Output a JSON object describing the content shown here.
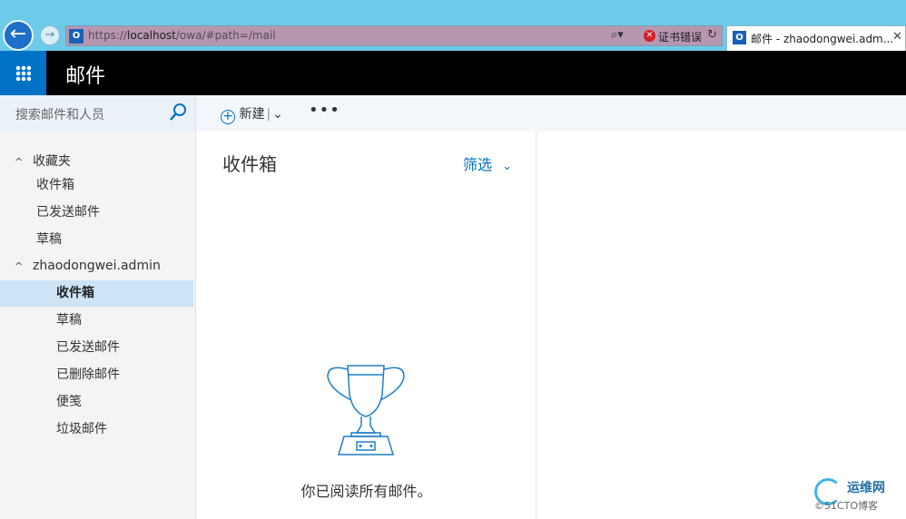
{
  "browser": {
    "url_prefix": "https://",
    "url_host": "localhost",
    "url_path": "/owa/#path=/mail",
    "cert_error": "证书错误",
    "tab_title": "邮件 - zhaodongwei.adm...",
    "favicon_letter": "O"
  },
  "header": {
    "app_title": "邮件"
  },
  "search": {
    "placeholder": "搜索邮件和人员"
  },
  "toolbar": {
    "new_label": "新建"
  },
  "nav": {
    "favorites_label": "收藏夹",
    "favorites": [
      "收件箱",
      "已发送邮件",
      "草稿"
    ],
    "account_label": "zhaodongwei.admin",
    "folders": [
      "收件箱",
      "草稿",
      "已发送邮件",
      "已删除邮件",
      "便笺",
      "垃圾邮件"
    ],
    "selected_folder": "收件箱"
  },
  "list": {
    "folder_title": "收件箱",
    "filter_label": "筛选",
    "empty_message": "你已阅读所有邮件。"
  },
  "watermark": {
    "brand": "运维网",
    "sub": "©51CTO博客"
  },
  "colors": {
    "accent": "#0072c6",
    "header_bg": "#000000",
    "chrome_bg": "#6ccbe8",
    "selected_bg": "#cde4f7"
  }
}
